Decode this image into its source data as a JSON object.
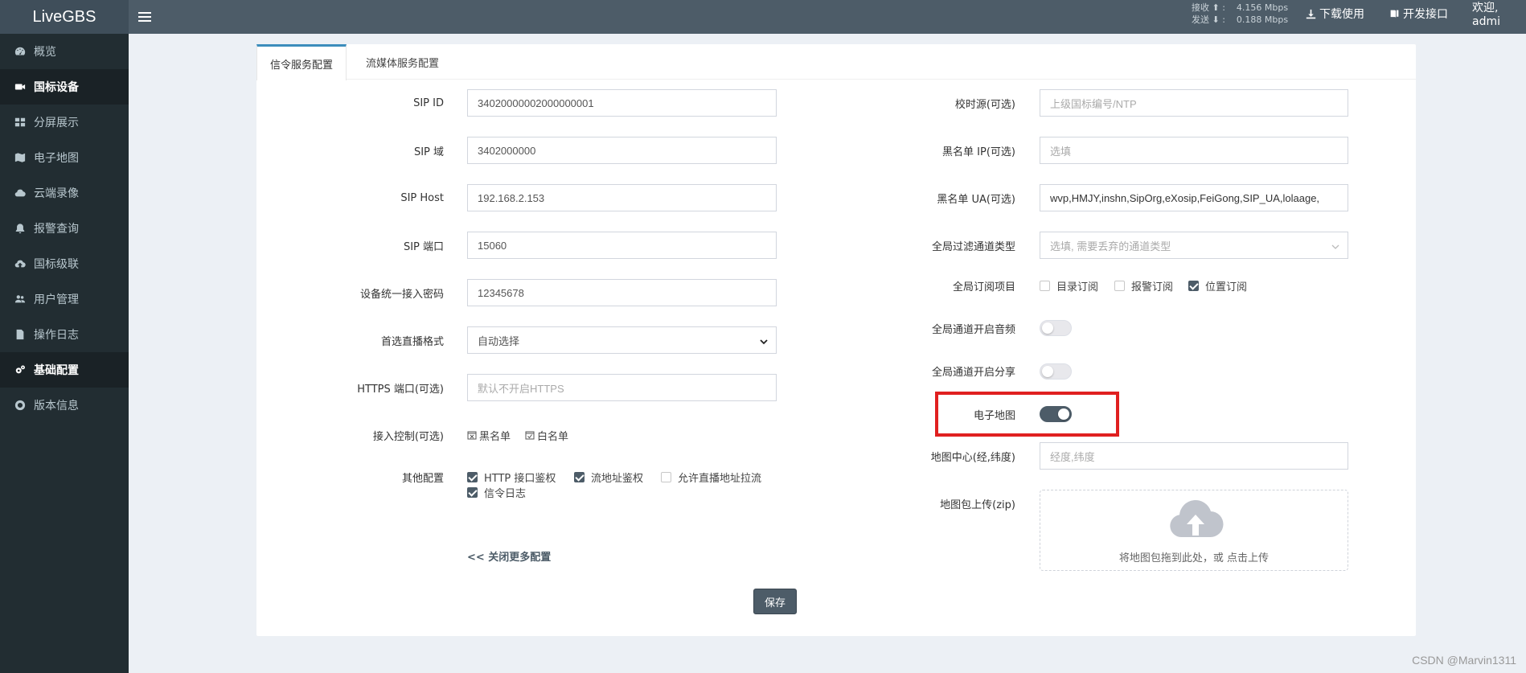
{
  "app": {
    "brand": "LiveGBS"
  },
  "sidebar": {
    "items": [
      {
        "label": "概览",
        "icon": "dashboard-icon"
      },
      {
        "label": "国标设备",
        "icon": "video-camera-icon"
      },
      {
        "label": "分屏展示",
        "icon": "grid-icon"
      },
      {
        "label": "电子地图",
        "icon": "map-icon"
      },
      {
        "label": "云端录像",
        "icon": "cloud-icon"
      },
      {
        "label": "报警查询",
        "icon": "bell-icon"
      },
      {
        "label": "国标级联",
        "icon": "cloud-upload-icon"
      },
      {
        "label": "用户管理",
        "icon": "users-icon"
      },
      {
        "label": "操作日志",
        "icon": "file-icon"
      },
      {
        "label": "基础配置",
        "icon": "gears-icon"
      },
      {
        "label": "版本信息",
        "icon": "life-ring-icon"
      }
    ]
  },
  "header": {
    "rx_label": "接收 ⬆ :",
    "rx_value": "4.156 Mbps",
    "tx_label": "发送 ⬇ :",
    "tx_value": "0.188 Mbps",
    "download": "下载使用",
    "api": "开发接口",
    "welcome": "欢迎, admi"
  },
  "tabs": [
    "信令服务配置",
    "流媒体服务配置"
  ],
  "left_form": {
    "sip_id": {
      "label": "SIP ID",
      "value": "34020000002000000001"
    },
    "sip_domain": {
      "label": "SIP 域",
      "value": "3402000000"
    },
    "sip_host": {
      "label": "SIP Host",
      "value": "192.168.2.153"
    },
    "sip_port": {
      "label": "SIP 端口",
      "value": "15060"
    },
    "password": {
      "label": "设备统一接入密码",
      "value": "12345678"
    },
    "stream_format": {
      "label": "首选直播格式",
      "value": "自动选择"
    },
    "https_port": {
      "label": "HTTPS 端口(可选)",
      "placeholder": "默认不开启HTTPS"
    },
    "access_control": {
      "label": "接入控制(可选)",
      "blacklist": "黑名单",
      "whitelist": "白名单"
    },
    "other": {
      "label": "其他配置",
      "http_auth": "HTTP 接口鉴权",
      "stream_auth": "流地址鉴权",
      "allow_pull": "允许直播地址拉流",
      "sip_log": "信令日志"
    },
    "collapse": "<<  关闭更多配置"
  },
  "right_form": {
    "time_source": {
      "label": "校时源(可选)",
      "placeholder": "上级国标编号/NTP"
    },
    "blacklist_ip": {
      "label": "黑名单 IP(可选)",
      "placeholder": "选填"
    },
    "blacklist_ua": {
      "label": "黑名单 UA(可选)",
      "value": "wvp,HMJY,inshn,SipOrg,eXosip,FeiGong,SIP_UA,lolaage,"
    },
    "filter_channel": {
      "label": "全局过滤通道类型",
      "placeholder": "选填, 需要丢弃的通道类型"
    },
    "subscribe": {
      "label": "全局订阅项目",
      "catalog": "目录订阅",
      "alarm": "报警订阅",
      "position": "位置订阅"
    },
    "audio": {
      "label": "全局通道开启音频"
    },
    "share": {
      "label": "全局通道开启分享"
    },
    "emap": {
      "label": "电子地图"
    },
    "map_center": {
      "label": "地图中心(经,纬度)",
      "placeholder": "经度,纬度"
    },
    "map_upload": {
      "label": "地图包上传(zip)",
      "hint": "将地图包拖到此处，或 点击上传"
    }
  },
  "save": "保存",
  "watermark": "CSDN @Marvin1311",
  "colors": {
    "sidebar": "#222d32",
    "header": "#4d5c68",
    "accent": "#3c8dbc",
    "highlight": "#e02020"
  }
}
